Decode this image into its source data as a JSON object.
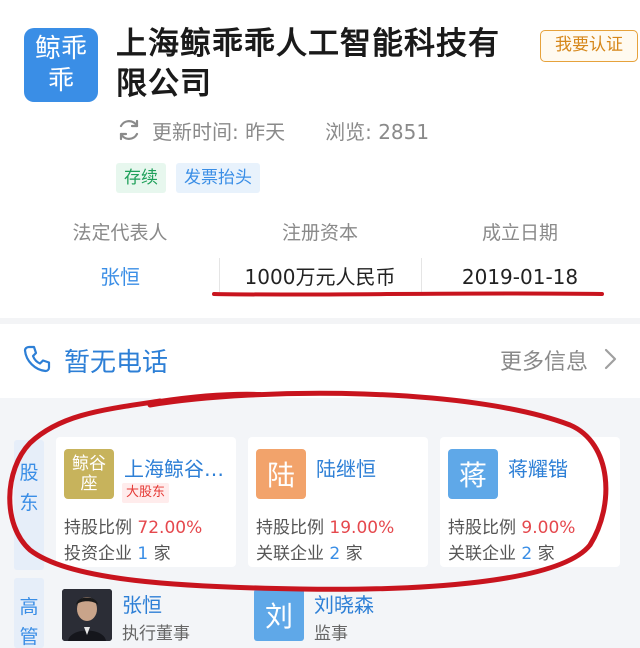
{
  "company": {
    "logo_text": "鲸乖乖",
    "name": "上海鲸乖乖人工智能科技有限公司",
    "verify_label": "我要认证",
    "update_label": "更新时间: 昨天",
    "views_label": "浏览: 2851",
    "tags": [
      "存续",
      "发票抬头"
    ]
  },
  "info": {
    "legal_rep_label": "法定代表人",
    "legal_rep_value": "张恒",
    "capital_label": "注册资本",
    "capital_value": "1000万元人民币",
    "founded_label": "成立日期",
    "founded_value": "2019-01-18"
  },
  "contact": {
    "phone_text": "暂无电话",
    "more_label": "更多信息"
  },
  "shareholders": {
    "section_label": "股东",
    "items": [
      {
        "avatar": "鲸谷座",
        "name": "上海鲸谷…",
        "badge": "大股东",
        "ratio_label": "持股比例",
        "ratio": "72.00%",
        "rel_label": "投资企业",
        "rel_count": "1",
        "unit": "家"
      },
      {
        "avatar": "陆",
        "name": "陆继恒",
        "ratio_label": "持股比例",
        "ratio": "19.00%",
        "rel_label": "关联企业",
        "rel_count": "2",
        "unit": "家"
      },
      {
        "avatar": "蒋",
        "name": "蒋耀锴",
        "ratio_label": "持股比例",
        "ratio": "9.00%",
        "rel_label": "关联企业",
        "rel_count": "2",
        "unit": "家"
      }
    ]
  },
  "executives": {
    "section_label": "高管",
    "items": [
      {
        "name": "张恒",
        "role": "执行董事"
      },
      {
        "avatar": "刘",
        "name": "刘晓森",
        "role": "监事"
      }
    ]
  },
  "colors": {
    "primary_blue": "#3a8ee6",
    "annotation_red": "#c8141e",
    "percent_red": "#e5484d",
    "verify_orange": "#d6871a"
  }
}
